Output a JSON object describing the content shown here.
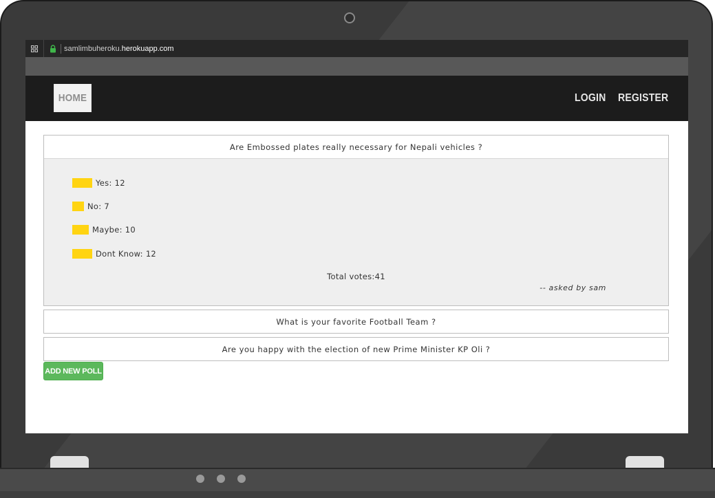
{
  "browser": {
    "url_subdomain": "samlimbuheroku.",
    "url_domain": "herokuapp.com"
  },
  "navbar": {
    "home_label": "HOME",
    "login_label": "LOGIN",
    "register_label": "REGISTER"
  },
  "polls": [
    {
      "question": "Are Embossed plates really necessary for Nepali vehicles ?",
      "options": [
        {
          "label": "Yes: 12",
          "votes": 12
        },
        {
          "label": "No: 7",
          "votes": 7
        },
        {
          "label": "Maybe: 10",
          "votes": 10
        },
        {
          "label": "Dont Know: 12",
          "votes": 12
        }
      ],
      "total": "Total votes:41",
      "asked_by": "-- asked by sam"
    },
    {
      "question": "What is your favorite Football Team ?"
    },
    {
      "question": "Are you happy with the election of new Prime Minister KP Oli ?"
    }
  ],
  "actions": {
    "add_poll_label": "ADD NEW POLL"
  },
  "colors": {
    "bar": "#ffd412",
    "button": "#5cb85c",
    "navbar": "#1c1c1c"
  },
  "icons": [
    "grid-icon",
    "lock-icon",
    "camera-icon"
  ]
}
